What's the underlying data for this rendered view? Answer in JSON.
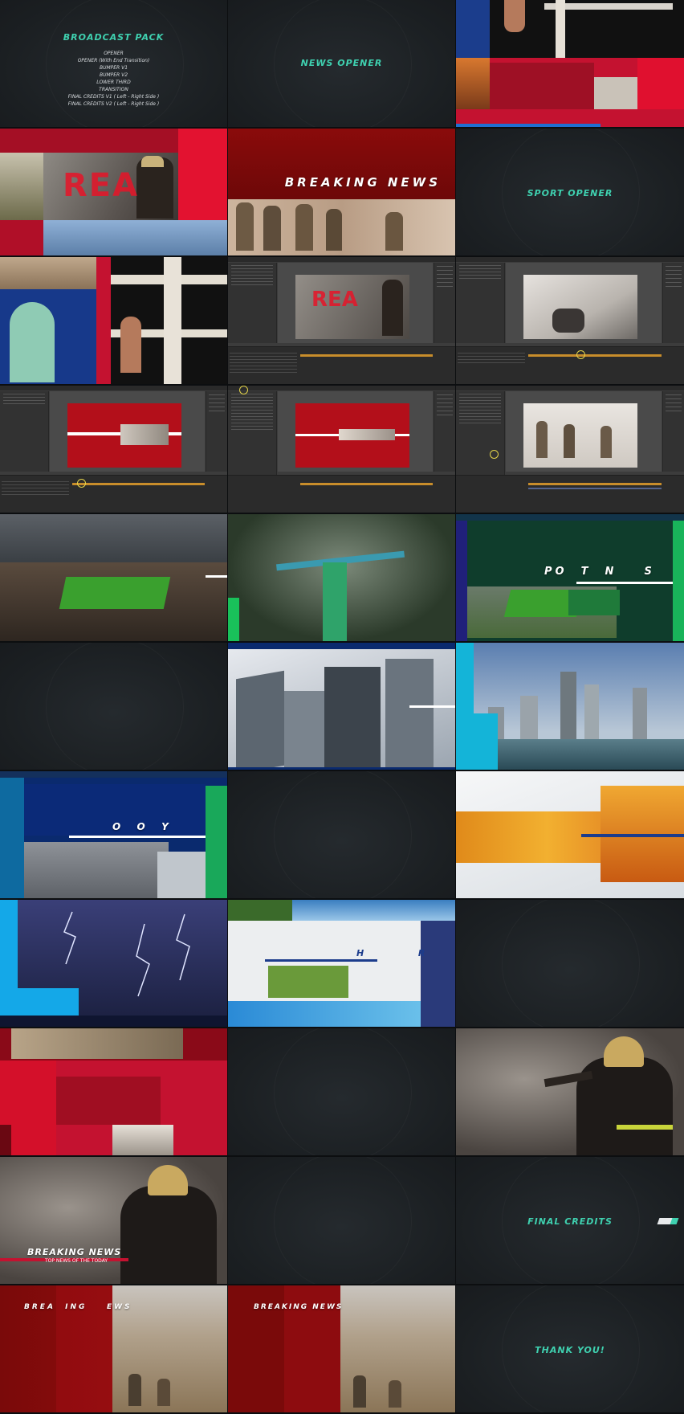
{
  "tiles": {
    "t1": {
      "title": "BROADCAST PACK",
      "items": [
        "OPENER",
        "OPENER (With End Transition)",
        "BUMPER V1",
        "BUMPER V2",
        "LOWER THIRD",
        "TRANSITION",
        "FINAL CREDITS V1 ( Left - Right Side )",
        "FINAL CREDITS V2 ( Left - Right Side )"
      ]
    },
    "t2": {
      "title": "NEWS OPENER"
    },
    "t4": {
      "big_text": "REA"
    },
    "t5": {
      "title": "BREAKING NEWS"
    },
    "t6": {
      "title": "SPORT OPENER"
    },
    "t8": {
      "big_text": "REA"
    },
    "t15": {
      "text": "PO  T  N    S"
    },
    "t19": {
      "text": "O  O  Y"
    },
    "t23": {
      "text": "H  R"
    },
    "t29": {
      "title": "BREAKING NEWS",
      "subtitle": "TOP NEWS OF THE TODAY"
    },
    "t30": {
      "title": "FINAL CREDITS"
    },
    "t31": {
      "title": "BREA  ING    EWS"
    },
    "t32": {
      "title": "BREAKING NEWS"
    },
    "t33": {
      "title": "THANK YOU!"
    }
  },
  "colors": {
    "mint": "#3fd1b0",
    "news_red": "#c41230",
    "dark_red": "#7a0a0a",
    "sport_green": "#0f3d2c",
    "news_blue": "#0a2a6e",
    "bg_dark": "#1d2124"
  }
}
